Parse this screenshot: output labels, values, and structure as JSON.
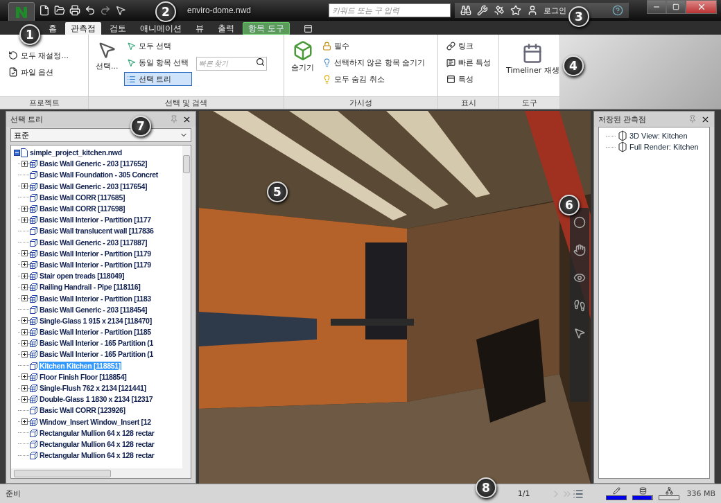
{
  "title_bar": {
    "title": "enviro-dome.nwd",
    "search": {
      "placeholder": "키워드 또는 구 입력"
    },
    "login": "로그인"
  },
  "ribbon_tabs": [
    {
      "label": "홈",
      "selected": false,
      "kind": "normal"
    },
    {
      "label": "관측점",
      "selected": true,
      "kind": "normal"
    },
    {
      "label": "검토",
      "selected": false,
      "kind": "normal"
    },
    {
      "label": "애니메이션",
      "selected": false,
      "kind": "normal"
    },
    {
      "label": "뷰",
      "selected": false,
      "kind": "normal"
    },
    {
      "label": "출력",
      "selected": false,
      "kind": "normal"
    },
    {
      "label": "항목 도구",
      "selected": false,
      "kind": "contextual"
    }
  ],
  "ribbon": {
    "project": {
      "title": "프로젝트",
      "reset_all": "모두 재설정...",
      "file_options": "파일 옵션"
    },
    "select_search": {
      "title": "선택 및 검색",
      "select": "선택...",
      "select_all": "모두 선택",
      "select_same": "동일 항목 선택",
      "selection_tree": {
        "label": "선택 트리",
        "on": true
      },
      "quick_find": {
        "placeholder": "빠른 찾기"
      }
    },
    "visibility": {
      "title": "가시성",
      "hide": "숨기기",
      "require": "필수",
      "hide_unselected": "선택하지 않은 항목 숨기기",
      "unhide_all": "모두 숨김 취소"
    },
    "display": {
      "title": "표시",
      "links": "링크",
      "quick_properties": "빠른 특성",
      "properties": "특성"
    },
    "tools": {
      "title": "도구",
      "timeliner": "Timeliner 재생"
    }
  },
  "selection_tree_panel": {
    "title": "선택 트리",
    "dropdown": "표준",
    "tree": {
      "label": "simple_project_kitchen.nwd",
      "expanded": true,
      "selected": false,
      "children": [
        {
          "label": "Basic Wall Generic - 203 [117652]",
          "kind": "group",
          "selected": false
        },
        {
          "label": "Basic Wall Foundation - 305 Concret",
          "kind": "object",
          "selected": false
        },
        {
          "label": "Basic Wall Generic - 203 [117654]",
          "kind": "group",
          "selected": false
        },
        {
          "label": "Basic Wall CORR [117685]",
          "kind": "object",
          "selected": false
        },
        {
          "label": "Basic Wall CORR [117698]",
          "kind": "group",
          "selected": false
        },
        {
          "label": "Basic Wall Interior - Partition [1177",
          "kind": "group",
          "selected": false
        },
        {
          "label": "Basic Wall translucent wall [117836",
          "kind": "object",
          "selected": false
        },
        {
          "label": "Basic Wall Generic - 203 [117887]",
          "kind": "object",
          "selected": false
        },
        {
          "label": "Basic Wall Interior - Partition [1179",
          "kind": "group",
          "selected": false
        },
        {
          "label": "Basic Wall Interior - Partition [1179",
          "kind": "group",
          "selected": false
        },
        {
          "label": "Stair open treads [118049]",
          "kind": "group",
          "selected": false
        },
        {
          "label": "Railing Handrail - Pipe [118116]",
          "kind": "group",
          "selected": false
        },
        {
          "label": "Basic Wall Interior - Partition [1183",
          "kind": "group",
          "selected": false
        },
        {
          "label": "Basic Wall Generic - 203 [118454]",
          "kind": "object",
          "selected": false
        },
        {
          "label": "Single-Glass 1 915 x 2134 [118470]",
          "kind": "group",
          "selected": false
        },
        {
          "label": "Basic Wall Interior - Partition [1185",
          "kind": "group",
          "selected": false
        },
        {
          "label": "Basic Wall Interior - 165 Partition (1",
          "kind": "group",
          "selected": false
        },
        {
          "label": "Basic Wall Interior - 165 Partition (1",
          "kind": "group",
          "selected": false
        },
        {
          "label": "Kitchen Kitchen [118851]",
          "kind": "object",
          "selected": true
        },
        {
          "label": "Floor Finish Floor [118854]",
          "kind": "group",
          "selected": false
        },
        {
          "label": "Single-Flush 762 x 2134 [121441]",
          "kind": "group",
          "selected": false
        },
        {
          "label": "Double-Glass 1 1830 x 2134 [12317",
          "kind": "group",
          "selected": false
        },
        {
          "label": "Basic Wall CORR [123926]",
          "kind": "object",
          "selected": false
        },
        {
          "label": "Window_Insert Window_Insert [12",
          "kind": "group",
          "selected": false
        },
        {
          "label": "Rectangular Mullion 64 x 128 rectar",
          "kind": "object",
          "selected": false
        },
        {
          "label": "Rectangular Mullion 64 x 128 rectar",
          "kind": "object",
          "selected": false
        },
        {
          "label": "Rectangular Mullion 64 x 128 rectar",
          "kind": "object",
          "selected": false
        }
      ]
    }
  },
  "saved_viewpoints_panel": {
    "title": "저장된 관측점",
    "viewpoints": [
      {
        "label": "3D View: Kitchen"
      },
      {
        "label": "Full Render: Kitchen"
      }
    ]
  },
  "status_bar": {
    "text": "준비",
    "page": "1/1",
    "meters": [
      {
        "level": 1
      },
      {
        "level": 0.95
      },
      {
        "level": 0
      }
    ],
    "memory": "336 MB"
  },
  "callouts": [
    "1",
    "2",
    "3",
    "4",
    "5",
    "6",
    "7",
    "8"
  ]
}
